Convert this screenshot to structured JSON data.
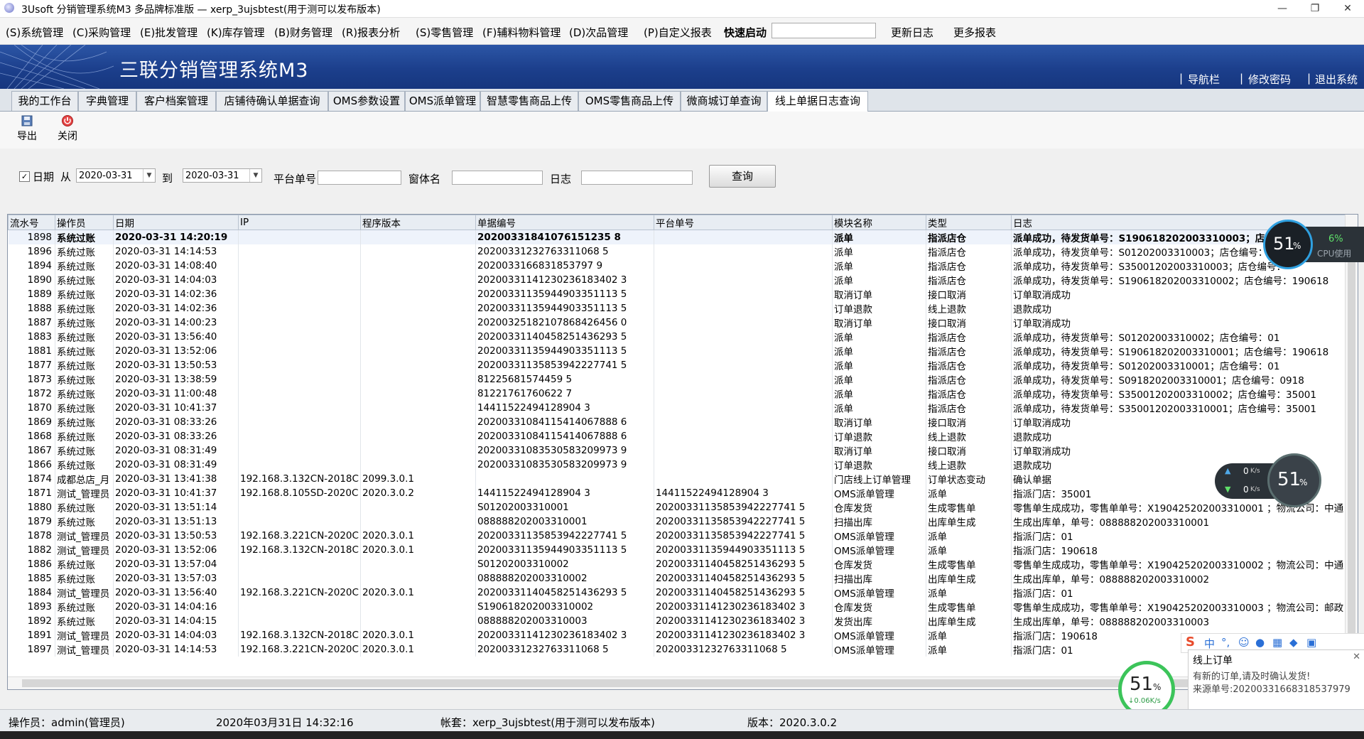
{
  "window": {
    "title": "3Usoft 分销管理系统M3 多品牌标准版 — xerp_3ujsbtest(用于测可以发布版本)",
    "minimize": "—",
    "maximize": "❐",
    "close": "✕"
  },
  "menu": {
    "items": [
      "(S)系统管理",
      "(C)采购管理",
      "(E)批发管理",
      "(K)库存管理",
      "(B)财务管理",
      "(R)报表分析",
      "(S)零售管理",
      "(F)辅料物料管理",
      "(D)次品管理",
      "(P)自定义报表"
    ],
    "quick_start": "快速启动",
    "update_log": "更新日志",
    "more_reports": "更多报表"
  },
  "banner": {
    "title": "三联分销管理系统M3",
    "links": [
      "导航栏",
      "修改密码",
      "退出系统"
    ],
    "sep": "|"
  },
  "tabs": [
    "我的工作台",
    "字典管理",
    "客户档案管理",
    "店铺待确认单据查询",
    "OMS参数设置",
    "OMS派单管理",
    "智慧零售商品上传",
    "OMS零售商品上传",
    "微商城订单查询",
    "线上单据日志查询"
  ],
  "active_tab_index": 9,
  "toolbar": {
    "export": "导出",
    "close": "关闭"
  },
  "filter": {
    "date_checked": true,
    "date_label": "日期",
    "from_label": "从",
    "from_value": "2020-03-31",
    "to_label": "到",
    "to_value": "2020-03-31",
    "platform_no_label": "平台单号",
    "shop_label": "窗体名",
    "log_label": "日志",
    "query_button": "查询"
  },
  "grid": {
    "columns": [
      "流水号",
      "操作员",
      "日期",
      "IP",
      "程序版本",
      "单据编号",
      "平台单号",
      "模块名称",
      "类型",
      "日志"
    ],
    "rows": [
      [
        "1898",
        "系统过账",
        "2020-03-31  14:20:19",
        "",
        "",
        "20200331841076151235 8",
        "",
        "派单",
        "指派店仓",
        "派单成功，待发货单号：S190618202003310003；店仓编号"
      ],
      [
        "1896",
        "系统过账",
        "2020-03-31  14:14:53",
        "",
        "",
        "20200331232763311068 5",
        "",
        "派单",
        "指派店仓",
        "派单成功，待发货单号：S01202003310003；店仓编号："
      ],
      [
        "1894",
        "系统过账",
        "2020-03-31  14:08:40",
        "",
        "",
        "2020033166831853797 9",
        "",
        "派单",
        "指派店仓",
        "派单成功，待发货单号：S35001202003310003；店仓编号："
      ],
      [
        "1890",
        "系统过账",
        "2020-03-31  14:04:03",
        "",
        "",
        "20200331141230236183402 3",
        "",
        "派单",
        "指派店仓",
        "派单成功，待发货单号：S190618202003310002；店仓编号：190618"
      ],
      [
        "1889",
        "系统过账",
        "2020-03-31  14:02:36",
        "",
        "",
        "20200331135944903351113 5",
        "",
        "取消订单",
        "接口取消",
        "订单取消成功"
      ],
      [
        "1888",
        "系统过账",
        "2020-03-31  14:02:36",
        "",
        "",
        "20200331135944903351113 5",
        "",
        "订单退款",
        "线上退款",
        "退款成功"
      ],
      [
        "1887",
        "系统过账",
        "2020-03-31  14:00:23",
        "",
        "",
        "20200325182107868426456 0",
        "",
        "取消订单",
        "接口取消",
        "订单取消成功"
      ],
      [
        "1883",
        "系统过账",
        "2020-03-31  13:56:40",
        "",
        "",
        "20200331140458251436293 5",
        "",
        "派单",
        "指派店仓",
        "派单成功，待发货单号：S01202003310002；店仓编号：01"
      ],
      [
        "1881",
        "系统过账",
        "2020-03-31  13:52:06",
        "",
        "",
        "20200331135944903351113 5",
        "",
        "派单",
        "指派店仓",
        "派单成功，待发货单号：S190618202003310001；店仓编号：190618"
      ],
      [
        "1877",
        "系统过账",
        "2020-03-31  13:50:53",
        "",
        "",
        "20200331135853942227741 5",
        "",
        "派单",
        "指派店仓",
        "派单成功，待发货单号：S01202003310001；店仓编号：01"
      ],
      [
        "1873",
        "系统过账",
        "2020-03-31  13:38:59",
        "",
        "",
        "81225681574459 5",
        "",
        "派单",
        "指派店仓",
        "派单成功，待发货单号：S0918202003310001；店仓编号：0918"
      ],
      [
        "1872",
        "系统过账",
        "2020-03-31  11:00:48",
        "",
        "",
        "81221761760622 7",
        "",
        "派单",
        "指派店仓",
        "派单成功，待发货单号：S35001202003310002；店仓编号：35001"
      ],
      [
        "1870",
        "系统过账",
        "2020-03-31  10:41:37",
        "",
        "",
        "14411522494128904 3",
        "",
        "派单",
        "指派店仓",
        "派单成功，待发货单号：S35001202003310001；店仓编号：35001"
      ],
      [
        "1869",
        "系统过账",
        "2020-03-31  08:33:26",
        "",
        "",
        "20200331084115414067888 6",
        "",
        "取消订单",
        "接口取消",
        "订单取消成功"
      ],
      [
        "1868",
        "系统过账",
        "2020-03-31  08:33:26",
        "",
        "",
        "20200331084115414067888 6",
        "",
        "订单退款",
        "线上退款",
        "退款成功"
      ],
      [
        "1867",
        "系统过账",
        "2020-03-31  08:31:49",
        "",
        "",
        "20200331083530583209973 9",
        "",
        "取消订单",
        "接口取消",
        "订单取消成功"
      ],
      [
        "1866",
        "系统过账",
        "2020-03-31  08:31:49",
        "",
        "",
        "20200331083530583209973 9",
        "",
        "订单退款",
        "线上退款",
        "退款成功"
      ],
      [
        "1874",
        "成都总店_月",
        "2020-03-31  13:41:38",
        "192.168.3.132CN-2018C",
        "2099.3.0.1",
        "",
        "",
        "门店线上订单管理",
        "订单状态变动",
        "确认单据"
      ],
      [
        "1871",
        "测试_管理员",
        "2020-03-31  10:41:37",
        "192.168.8.105SD-2020C",
        "2020.3.0.2",
        "14411522494128904 3",
        "14411522494128904 3",
        "OMS派单管理",
        "派单",
        "指派门店：35001"
      ],
      [
        "1880",
        "系统过账",
        "2020-03-31  13:51:14",
        "",
        "",
        "S01202003310001",
        "20200331135853942227741 5",
        "仓库发货",
        "生成零售单",
        "零售单生成成功，零售单单号：X190425202003310001 ；物流公司：中通"
      ],
      [
        "1879",
        "系统过账",
        "2020-03-31  13:51:13",
        "",
        "",
        "088888202003310001",
        "20200331135853942227741 5",
        "扫描出库",
        "出库单生成",
        "生成出库单，单号：088888202003310001"
      ],
      [
        "1878",
        "测试_管理员",
        "2020-03-31  13:50:53",
        "192.168.3.221CN-2020C",
        "2020.3.0.1",
        "20200331135853942227741 5",
        "20200331135853942227741 5",
        "OMS派单管理",
        "派单",
        "指派门店：01"
      ],
      [
        "1882",
        "测试_管理员",
        "2020-03-31  13:52:06",
        "192.168.3.132CN-2018C",
        "2020.3.0.1",
        "20200331135944903351113 5",
        "20200331135944903351113 5",
        "OMS派单管理",
        "派单",
        "指派门店：190618"
      ],
      [
        "1886",
        "系统过账",
        "2020-03-31  13:57:04",
        "",
        "",
        "S01202003310002",
        "20200331140458251436293 5",
        "仓库发货",
        "生成零售单",
        "零售单生成成功，零售单单号：X190425202003310002 ；物流公司：中通"
      ],
      [
        "1885",
        "系统过账",
        "2020-03-31  13:57:03",
        "",
        "",
        "088888202003310002",
        "20200331140458251436293 5",
        "扫描出库",
        "出库单生成",
        "生成出库单，单号：088888202003310002"
      ],
      [
        "1884",
        "测试_管理员",
        "2020-03-31  13:56:40",
        "192.168.3.221CN-2020C",
        "2020.3.0.1",
        "20200331140458251436293 5",
        "20200331140458251436293 5",
        "OMS派单管理",
        "派单",
        "指派门店：01"
      ],
      [
        "1893",
        "系统过账",
        "2020-03-31  14:04:16",
        "",
        "",
        "S190618202003310002",
        "20200331141230236183402 3",
        "仓库发货",
        "生成零售单",
        "零售单生成成功，零售单单号：X190425202003310003 ；物流公司：邮政"
      ],
      [
        "1892",
        "系统过账",
        "2020-03-31  14:04:15",
        "",
        "",
        "088888202003310003",
        "20200331141230236183402 3",
        "发货出库",
        "出库单生成",
        "生成出库单，单号：088888202003310003"
      ],
      [
        "1891",
        "测试_管理员",
        "2020-03-31  14:04:03",
        "192.168.3.132CN-2018C",
        "2020.3.0.1",
        "20200331141230236183402 3",
        "20200331141230236183402 3",
        "OMS派单管理",
        "派单",
        "指派门店：190618"
      ],
      [
        "1897",
        "测试_管理员",
        "2020-03-31  14:14:53",
        "192.168.3.221CN-2020C",
        "2020.3.0.1",
        "20200331232763311068 5",
        "20200331232763311068 5",
        "OMS派单管理",
        "派单",
        "指派门店：01"
      ]
    ]
  },
  "status": {
    "operator": "操作员：admin(管理员)",
    "datetime": "2020年03月31日 14:32:16",
    "account": "帐套：xerp_3ujsbtest(用于测可以发布版本)",
    "version": "版本：2020.3.0.2"
  },
  "cpu_widget": {
    "percent": "51",
    "unit": "%",
    "usage": "6%",
    "label": "CPU使用"
  },
  "net_widget": {
    "up": "0",
    "down": "0",
    "unit": "K/s",
    "percent": "51",
    "unit2": "%"
  },
  "mon_widget": {
    "percent": "51",
    "unit": "%",
    "speed": "↓0.06K/s"
  },
  "ime": {
    "brand": "S",
    "lang": "中"
  },
  "notify": {
    "title": "线上订单",
    "line1": "有新的订单,请及时确认发货!",
    "line2": "来源单号:20200331668318537979"
  }
}
